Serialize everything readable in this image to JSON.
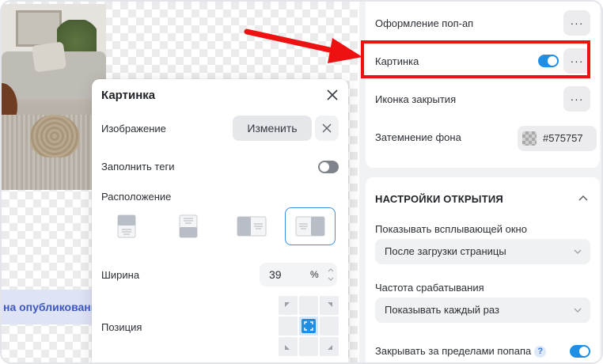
{
  "canvas": {
    "published_text": "на опубликованной"
  },
  "picture_panel": {
    "title": "Картинка",
    "image_label": "Изображение",
    "change_button": "Изменить",
    "fill_tags_label": "Заполнить теги",
    "fill_tags_on": false,
    "layout_label": "Расположение",
    "layout_options": [
      "image-top",
      "image-bottom",
      "image-left",
      "image-right"
    ],
    "layout_selected": "image-right",
    "width_label": "Ширина",
    "width_value": "39",
    "width_unit": "%",
    "position_label": "Позиция",
    "position_selected": "center"
  },
  "settings": {
    "popup_design_label": "Оформление поп-ап",
    "picture_label": "Картинка",
    "picture_on": true,
    "close_icon_label": "Иконка закрытия",
    "background_dim_label": "Затемнение фона",
    "background_dim_color": "#575757",
    "open_section_title": "НАСТРОЙКИ ОТКРЫТИЯ",
    "show_popup_label": "Показывать всплывающей окно",
    "show_popup_value": "После загрузки страницы",
    "frequency_label": "Частота срабатывания",
    "frequency_value": "Показывать каждый раз",
    "close_outside_label": "Закрывать за пределами попапа",
    "close_outside_on": true,
    "help_symbol": "?"
  },
  "colors": {
    "accent": "#1f8fe6",
    "highlight": "#ee1111",
    "published_text": "#3d58c2"
  }
}
